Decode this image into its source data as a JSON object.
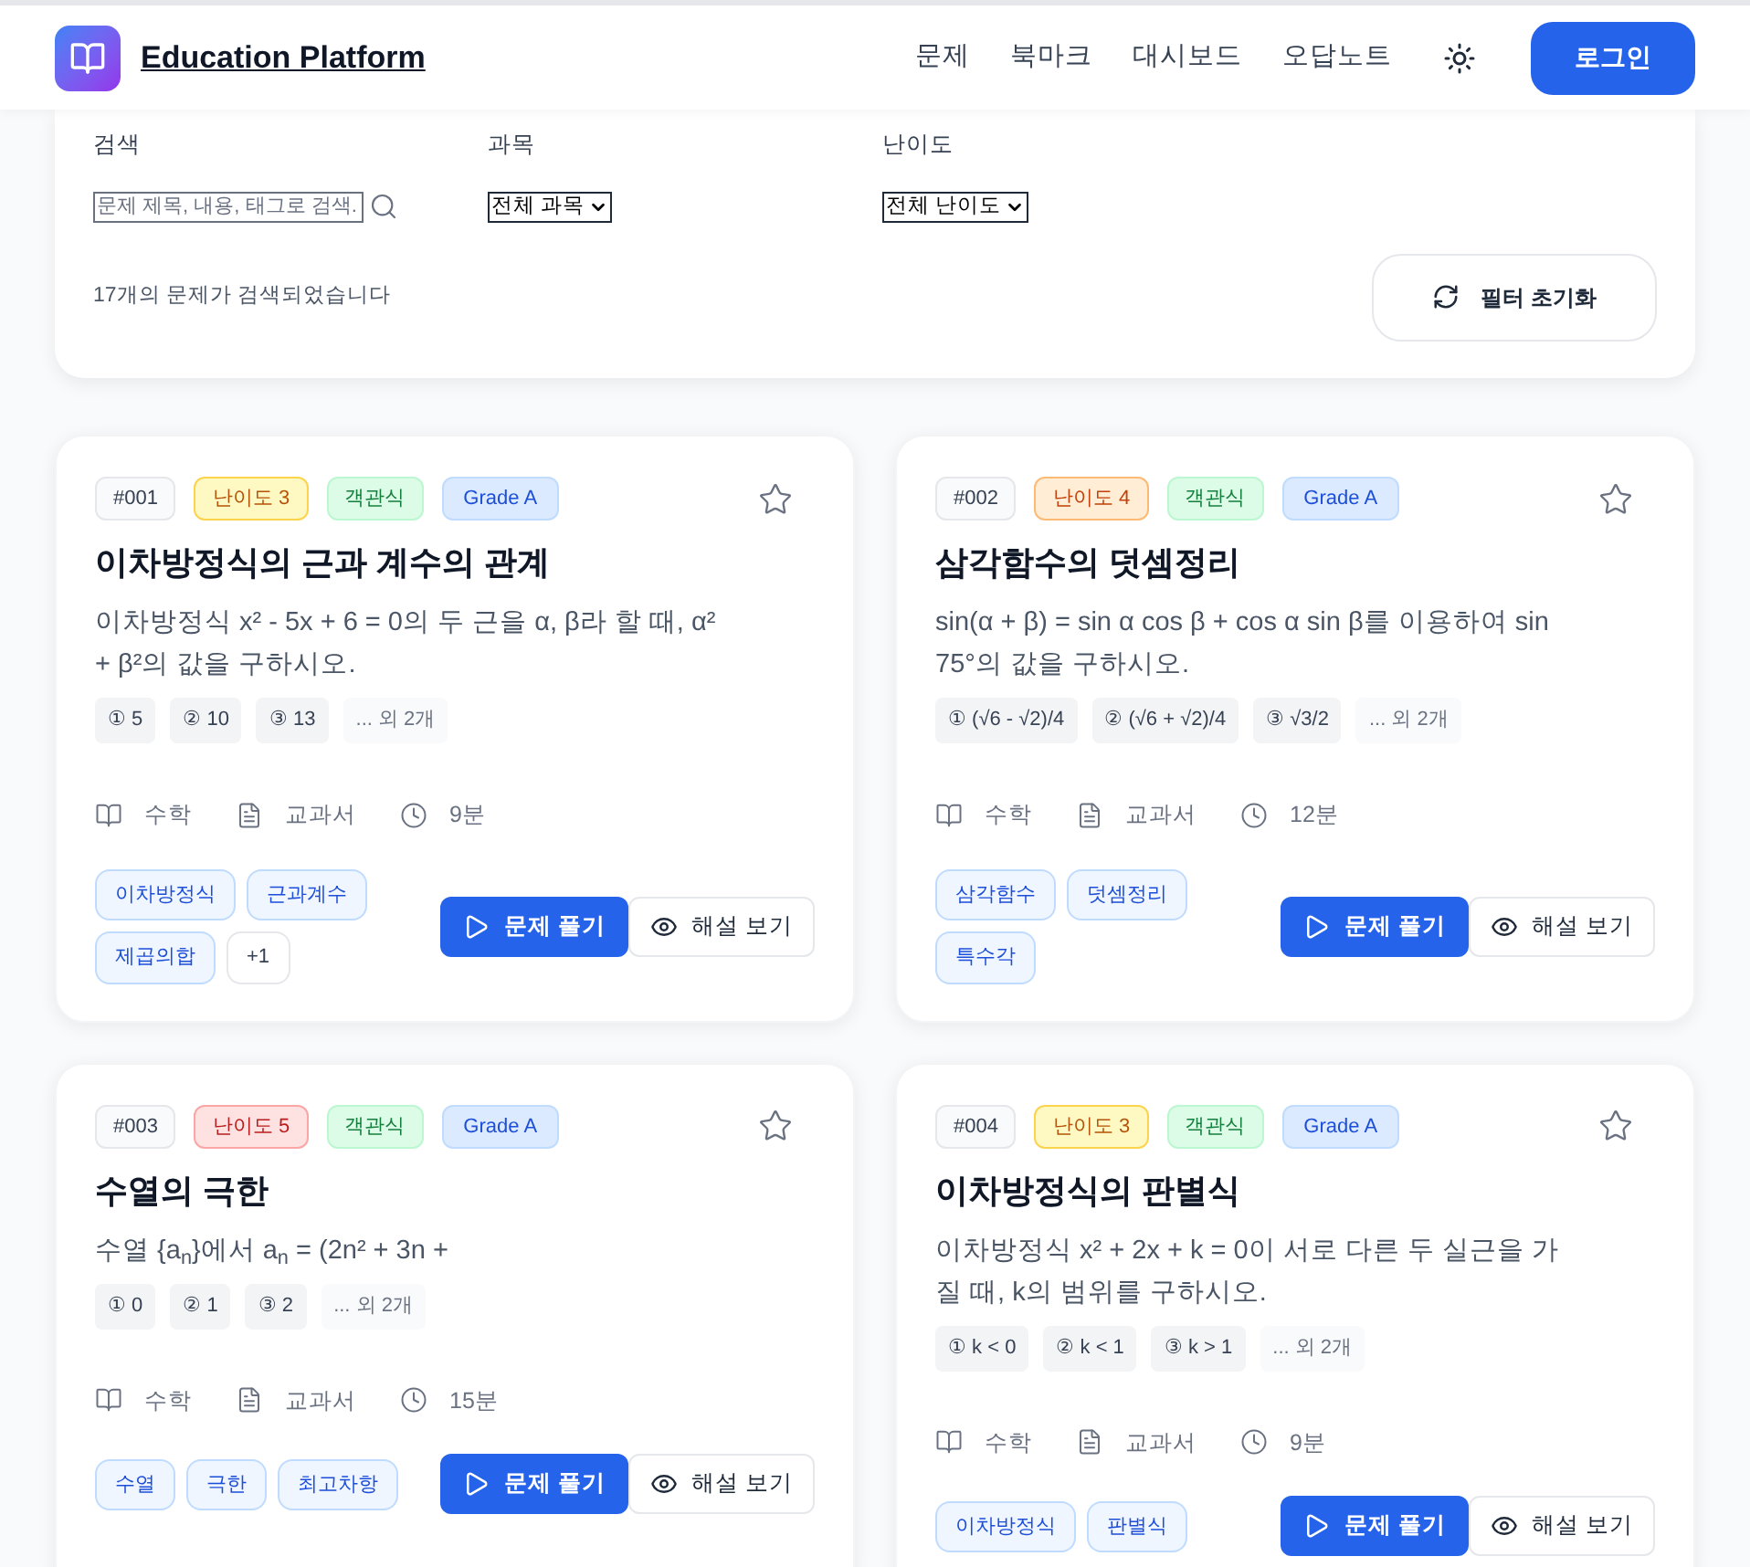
{
  "header": {
    "brand": "Education Platform",
    "nav": [
      "문제",
      "북마크",
      "대시보드",
      "오답노트"
    ],
    "login": "로그인"
  },
  "filters": {
    "search": {
      "label": "검색",
      "placeholder": "문제 제목, 내용, 태그로 검색."
    },
    "subject": {
      "label": "과목",
      "value": "전체 과목"
    },
    "difficulty": {
      "label": "난이도",
      "value": "전체 난이도"
    },
    "result_count": "17개의 문제가 검색되었습니다",
    "reset": "필터 초기화"
  },
  "problems": [
    {
      "id": "#001",
      "difficulty": {
        "text": "난이도 3",
        "kind": "medium"
      },
      "type": "객관식",
      "grade": "Grade A",
      "bookmarked": false,
      "title": "이차방정식의 근과 계수의 관계",
      "description": "이차방정식 x² - 5x + 6 = 0의 두 근을 α, β라 할 때, α² + β²의 값을 구하시오.",
      "choices": [
        "① 5",
        "② 10",
        "③ 13"
      ],
      "more_choices": "... 외 2개",
      "subject": "수학",
      "source": "교과서",
      "time": "9분",
      "tags": [
        "이차방정식",
        "근과계수",
        "제곱의합"
      ],
      "more_tags": "+1",
      "solve": "문제 풀기",
      "solution": "해설 보기"
    },
    {
      "id": "#002",
      "difficulty": {
        "text": "난이도 4",
        "kind": "hard"
      },
      "type": "객관식",
      "grade": "Grade A",
      "bookmarked": false,
      "title": "삼각함수의 덧셈정리",
      "description": "sin(α + β) = sin α cos β + cos α sin β를 이용하여 sin 75°의 값을 구하시오.",
      "choices": [
        "① (√6 - √2)/4",
        "② (√6 + √2)/4",
        "③ √3/2"
      ],
      "more_choices": "... 외 2개",
      "subject": "수학",
      "source": "교과서",
      "time": "12분",
      "tags": [
        "삼각함수",
        "덧셈정리",
        "특수각"
      ],
      "solve": "문제 풀기",
      "solution": "해설 보기"
    },
    {
      "id": "#003",
      "difficulty": {
        "text": "난이도 5",
        "kind": "very_hard"
      },
      "type": "객관식",
      "grade": "Grade A",
      "bookmarked": false,
      "title": "수열의 극한",
      "description": "수열 {a$_{n}$}에서 a$_{n}$ = (2n² + 3n +",
      "choices": [
        "① 0",
        "② 1",
        "③ 2"
      ],
      "more_choices": "... 외 2개",
      "subject": "수학",
      "source": "교과서",
      "time": "15분",
      "tags": [
        "수열",
        "극한",
        "최고차항"
      ],
      "solve": "문제 풀기",
      "solution": "해설 보기"
    },
    {
      "id": "#004",
      "difficulty": {
        "text": "난이도 3",
        "kind": "medium"
      },
      "type": "객관식",
      "grade": "Grade A",
      "bookmarked": false,
      "title": "이차방정식의 판별식",
      "description": "이차방정식 x² + 2x + k = 0이 서로 다른 두 실근을 가질 때, k의 범위를 구하시오.",
      "choices": [
        "① k < 0",
        "② k < 1",
        "③ k > 1"
      ],
      "more_choices": "... 외 2개",
      "subject": "수학",
      "source": "교과서",
      "time": "9분",
      "tags": [
        "이차방정식",
        "판별식"
      ],
      "solve": "문제 풀기",
      "solution": "해설 보기"
    }
  ]
}
